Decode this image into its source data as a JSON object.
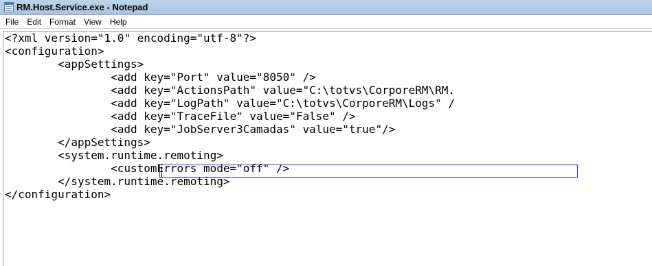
{
  "window": {
    "title": "RM.Host.Service.exe - Notepad"
  },
  "menu": [
    "File",
    "Edit",
    "Format",
    "View",
    "Help"
  ],
  "editor": {
    "lines": [
      "<?xml version=\"1.0\" encoding=\"utf-8\"?>",
      "<configuration>",
      "        <appSettings>",
      "                <add key=\"Port\" value=\"8050\" />",
      "                <add key=\"ActionsPath\" value=\"C:\\totvs\\CorporeRM\\RM.",
      "                <add key=\"LogPath\" value=\"C:\\totvs\\CorporeRM\\Logs\" /",
      "                <add key=\"TraceFile\" value=\"False\" />",
      "                <add key=\"JobServer3Camadas\" value=\"true\"/>",
      "        </appSettings>",
      "        <system.runtime.remoting>",
      "                <customErrors mode=\"off\" />",
      "        </system.runtime.remoting>",
      "</configuration>"
    ],
    "highlight_color": "#2a36d8"
  }
}
